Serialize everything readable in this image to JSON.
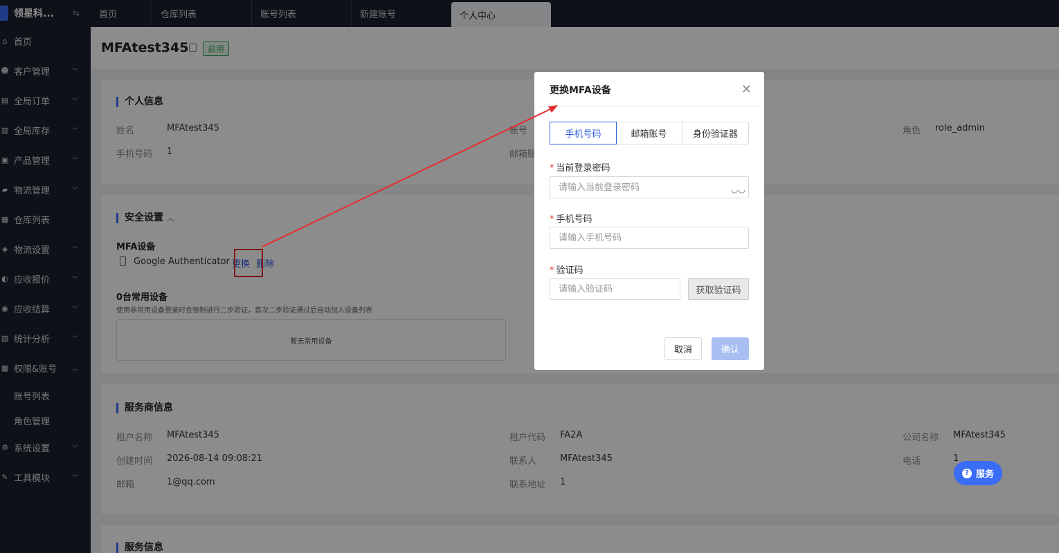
{
  "app": {
    "name": "领星科..."
  },
  "sidebar": {
    "items": [
      {
        "label": "首页",
        "icon": "home-icon",
        "glyph": "⌂",
        "chevron": false
      },
      {
        "label": "客户管理",
        "icon": "users-icon",
        "glyph": "☻",
        "chevron": true
      },
      {
        "label": "全局订单",
        "icon": "order-icon",
        "glyph": "▤",
        "chevron": true
      },
      {
        "label": "全局库存",
        "icon": "inventory-icon",
        "glyph": "▥",
        "chevron": true
      },
      {
        "label": "产品管理",
        "icon": "product-icon",
        "glyph": "▣",
        "chevron": true
      },
      {
        "label": "物流管理",
        "icon": "truck-icon",
        "glyph": "▰",
        "chevron": true
      },
      {
        "label": "仓库列表",
        "icon": "warehouse-icon",
        "glyph": "▦",
        "chevron": false
      },
      {
        "label": "物流设置",
        "icon": "logistics-settings-icon",
        "glyph": "◈",
        "chevron": true
      },
      {
        "label": "应收报价",
        "icon": "quote-icon",
        "glyph": "◐",
        "chevron": true
      },
      {
        "label": "应收结算",
        "icon": "settlement-icon",
        "glyph": "◉",
        "chevron": true
      },
      {
        "label": "统计分析",
        "icon": "chart-icon",
        "glyph": "▧",
        "chevron": true
      },
      {
        "label": "权限&账号",
        "icon": "permission-icon",
        "glyph": "▩",
        "chevron": true,
        "expanded": true
      }
    ],
    "sub_items": [
      "账号列表",
      "角色管理"
    ],
    "bottom_items": [
      {
        "label": "系统设置",
        "icon": "gear-icon",
        "glyph": "⚙"
      },
      {
        "label": "工具模块",
        "icon": "wrench-icon",
        "glyph": "✎"
      }
    ]
  },
  "tabs": [
    "首页",
    "仓库列表",
    "账号列表",
    "新建账号",
    "个人中心"
  ],
  "page": {
    "title": "MFAtest345",
    "status": "启用"
  },
  "personal": {
    "title": "个人信息",
    "name_label": "姓名",
    "name": "MFAtest345",
    "phone_label": "手机号码",
    "phone": "1",
    "account_label": "账号",
    "email_label": "邮箱账",
    "role_label": "角色",
    "role": "role_admin"
  },
  "security": {
    "title": "安全设置",
    "mfa_title": "MFA设备",
    "mfa_device": "Google Authenticator",
    "change": "更换",
    "delete": "删除",
    "devices_title": "0台常用设备",
    "devices_desc": "使用非常用设备登录时会强制进行二步验证，首次二步验证通过后自动加入设备列表",
    "devices_empty": "暂无常用设备"
  },
  "provider": {
    "title": "服务商信息",
    "tenant_name_label": "租户名称",
    "tenant_name": "MFAtest345",
    "tenant_code_label": "租户代码",
    "tenant_code": "FA2A",
    "company_label": "公司名称",
    "company": "MFAtest345",
    "created_label": "创建时间",
    "created": "2026-08-14 09:08:21",
    "contact_label": "联系人",
    "contact": "MFAtest345",
    "tel_label": "电话",
    "tel": "1",
    "email_label": "邮箱",
    "email": "1@qq.com",
    "address_label": "联系地址",
    "address": "1"
  },
  "service_info": {
    "title": "服务信息"
  },
  "modal": {
    "title": "更换MFA设备",
    "tabs": [
      "手机号码",
      "邮箱账号",
      "身份验证器"
    ],
    "password_label": "当前登录密码",
    "password_placeholder": "请输入当前登录密码",
    "phone_label": "手机号码",
    "phone_placeholder": "请输入手机号码",
    "code_label": "验证码",
    "code_placeholder": "请输入验证码",
    "get_code": "获取验证码",
    "cancel": "取消",
    "confirm": "确认"
  },
  "service_button": "服务",
  "colors": {
    "accent": "#3b6cf6",
    "danger": "#e52d2d",
    "success": "#3aa55b",
    "sidebar": "#1b1f2a"
  }
}
